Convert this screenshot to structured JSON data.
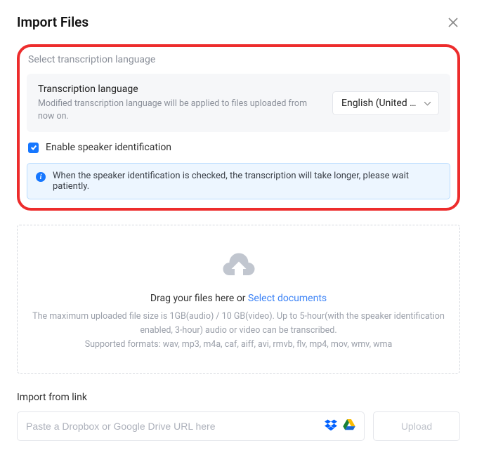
{
  "header": {
    "title": "Import Files"
  },
  "transcription": {
    "section_label": "Select transcription language",
    "lang_title": "Transcription language",
    "lang_subtitle": "Modified transcription language will be applied to files uploaded from now on.",
    "selected_language": "English (United S...",
    "checkbox_label": "Enable speaker identification",
    "checkbox_checked": true,
    "info_text": "When the speaker identification is checked, the transcription will take longer, please wait patiently."
  },
  "dropzone": {
    "drag_text": "Drag your files here or ",
    "select_link": "Select documents",
    "info_line1": "The maximum uploaded file size is 1GB(audio) / 10 GB(video). Up to 5-hour(with the speaker identification enabled, 3-hour) audio or video can be transcribed.",
    "info_line2": "Supported formats: wav, mp3, m4a, caf, aiff, avi, rmvb, flv, mp4, mov, wmv, wma"
  },
  "import_link": {
    "label": "Import from link",
    "placeholder": "Paste a Dropbox or Google Drive URL here",
    "upload_button": "Upload"
  }
}
